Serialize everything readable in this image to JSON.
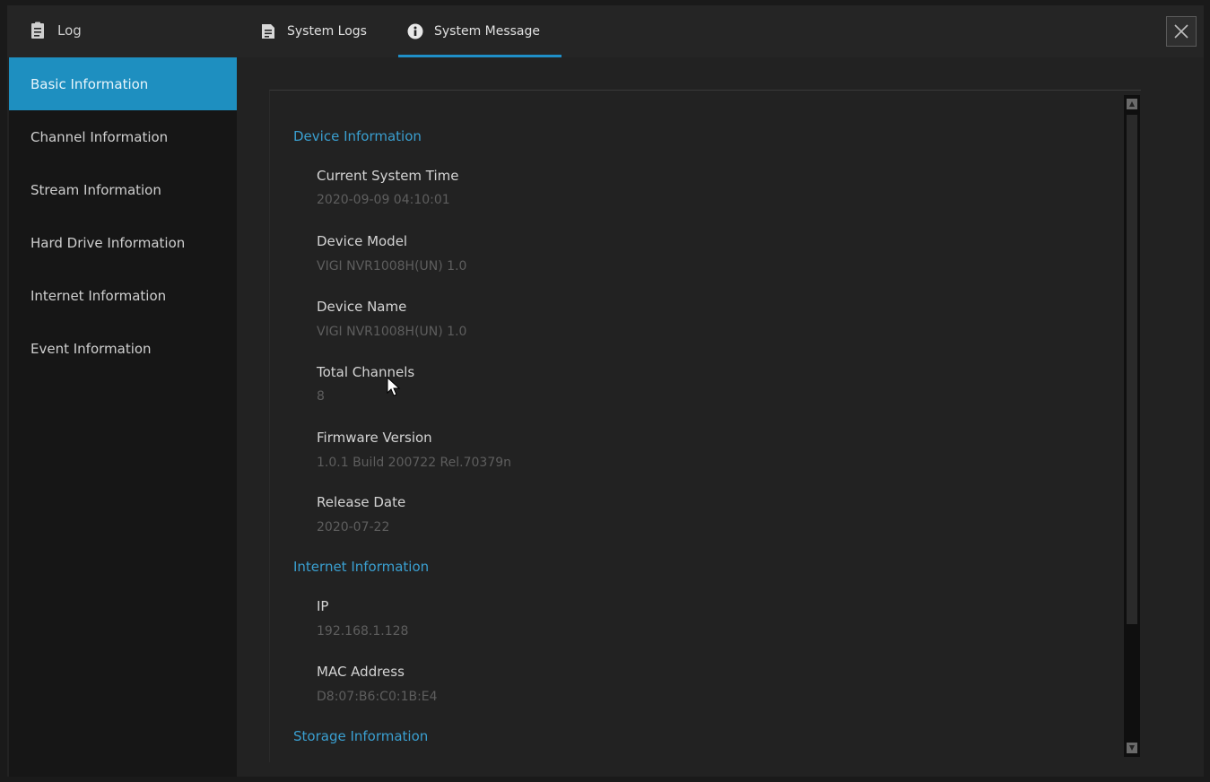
{
  "window": {
    "title": "Log",
    "title_icon": "clipboard-icon"
  },
  "tabs": [
    {
      "label": "System Logs",
      "icon": "document-icon",
      "active": false
    },
    {
      "label": "System Message",
      "icon": "info-icon",
      "active": true
    }
  ],
  "close_icon": "close-icon",
  "sidebar": {
    "items": [
      {
        "label": "Basic Information",
        "active": true
      },
      {
        "label": "Channel Information",
        "active": false
      },
      {
        "label": "Stream Information",
        "active": false
      },
      {
        "label": "Hard Drive Information",
        "active": false
      },
      {
        "label": "Internet Information",
        "active": false
      },
      {
        "label": "Event Information",
        "active": false
      }
    ]
  },
  "content": {
    "device_section": "Device Information",
    "fields": {
      "current_system_time": {
        "label": "Current System Time",
        "value": "2020-09-09 04:10:01"
      },
      "device_model": {
        "label": "Device Model",
        "value": "VIGI NVR1008H(UN) 1.0"
      },
      "device_name": {
        "label": "Device Name",
        "value": "VIGI NVR1008H(UN) 1.0"
      },
      "total_channels": {
        "label": "Total Channels",
        "value": "8"
      },
      "firmware_version": {
        "label": "Firmware Version",
        "value": "1.0.1 Build 200722 Rel.70379n"
      },
      "release_date": {
        "label": "Release Date",
        "value": "2020-07-22"
      }
    },
    "internet_section": "Internet Information",
    "internet_fields": {
      "ip": {
        "label": "IP",
        "value": "192.168.1.128"
      },
      "mac_address": {
        "label": "MAC Address",
        "value": "D8:07:B6:C0:1B:E4"
      }
    },
    "storage_section": "Storage Information"
  },
  "colors": {
    "accent": "#1e8fc0",
    "section_header": "#3a9fd0",
    "background": "#222222"
  }
}
